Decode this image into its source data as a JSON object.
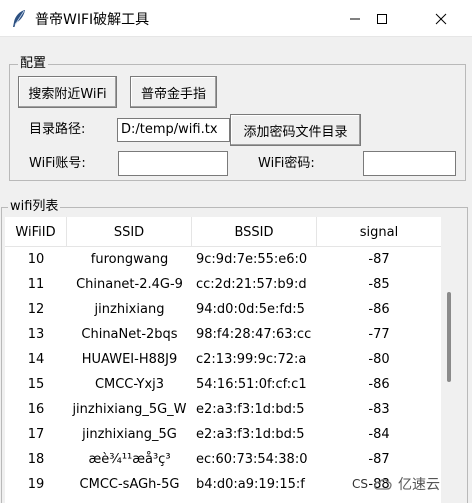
{
  "window": {
    "title": "普帝WIFI破解工具",
    "icon": "feather-icon",
    "controls": [
      "minimize-icon",
      "maximize-icon",
      "close-icon"
    ]
  },
  "config": {
    "group_label": "配置",
    "search_button": "搜索附近WiFi",
    "cheat_button": "普帝金手指",
    "dir_label": "目录路径:",
    "dir_value": "D:/temp/wifi.tx",
    "add_dir_button": "添加密码文件目录",
    "account_label": "WiFi账号:",
    "account_value": "",
    "password_label": "WiFi密码:",
    "password_value": ""
  },
  "wifi_list": {
    "group_label": "wifi列表",
    "columns": [
      "WiFiID",
      "SSID",
      "BSSID",
      "signal"
    ],
    "rows": [
      {
        "id": "10",
        "ssid": "furongwang",
        "bssid": "9c:9d:7e:55:e6:0",
        "signal": "-87"
      },
      {
        "id": "11",
        "ssid": "Chinanet-2.4G-9",
        "bssid": "cc:2d:21:57:b9:d",
        "signal": "-85"
      },
      {
        "id": "12",
        "ssid": "jinzhixiang",
        "bssid": "94:d0:0d:5e:fd:5",
        "signal": "-86"
      },
      {
        "id": "13",
        "ssid": "ChinaNet-2bqs",
        "bssid": "98:f4:28:47:63:cc",
        "signal": "-77"
      },
      {
        "id": "14",
        "ssid": "HUAWEI-H88J9",
        "bssid": "c2:13:99:9c:72:a",
        "signal": "-80"
      },
      {
        "id": "15",
        "ssid": "CMCC-Yxj3",
        "bssid": "54:16:51:0f:cf:c1",
        "signal": "-86"
      },
      {
        "id": "16",
        "ssid": "jinzhixiang_5G_W",
        "bssid": "e2:a3:f3:1d:bd:5",
        "signal": "-83"
      },
      {
        "id": "17",
        "ssid": "jinzhixiang_5G",
        "bssid": "e2:a3:f3:1d:bd:5",
        "signal": "-84"
      },
      {
        "id": "18",
        "ssid": "æè¾¹¹æå³ç³",
        "bssid": "ec:60:73:54:38:0",
        "signal": "-87"
      },
      {
        "id": "19",
        "ssid": "CMCC-sAGh-5G",
        "bssid": "b4:d0:a9:19:15:f",
        "signal": "-88"
      }
    ]
  },
  "watermark": {
    "text": "亿速云",
    "icon": "cloud-logo-icon",
    "partial_text": "CS"
  }
}
